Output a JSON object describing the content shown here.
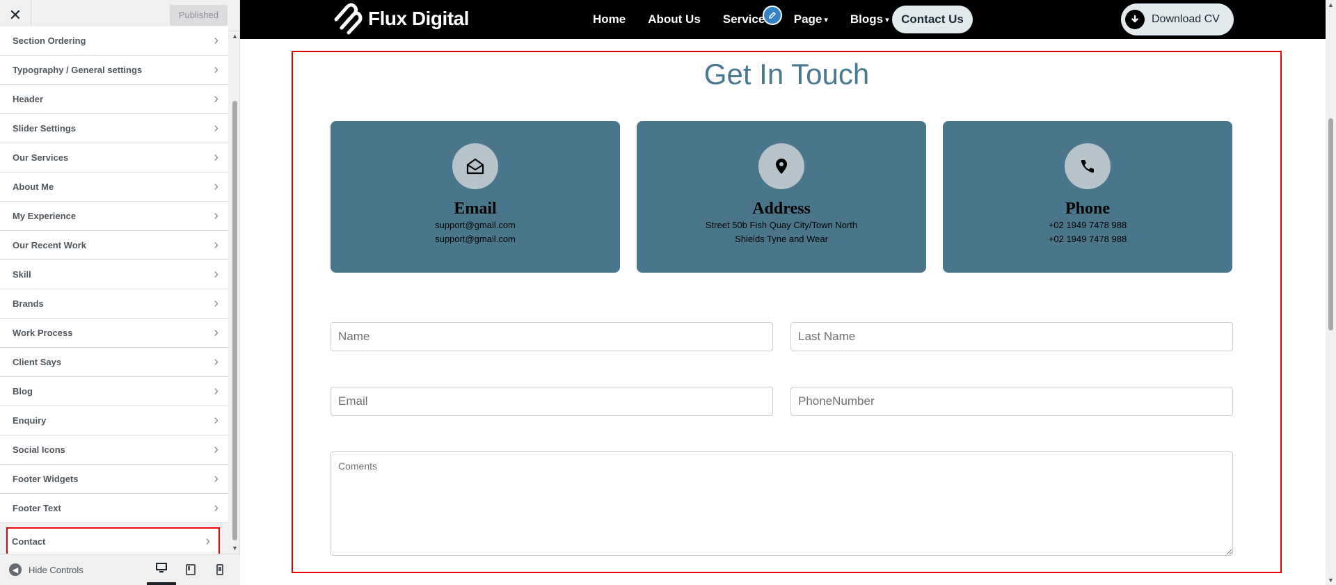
{
  "customizer": {
    "publish_label": "Published",
    "sections": [
      "Section Ordering",
      "Typography / General settings",
      "Header",
      "Slider Settings",
      "Our Services",
      "About Me",
      "My Experience",
      "Our Recent Work",
      "Skill",
      "Brands",
      "Work Process",
      "Client Says",
      "Blog",
      "Enquiry",
      "Social Icons",
      "Footer Widgets",
      "Footer Text",
      "Contact"
    ],
    "active_section": "Contact",
    "hide_controls": "Hide Controls",
    "devices": [
      "desktop-icon",
      "tablet-icon",
      "mobile-icon"
    ]
  },
  "site": {
    "brand": "Flux Digital",
    "menu": {
      "home": "Home",
      "about": "About Us",
      "services": "Services",
      "page": "Page",
      "blogs": "Blogs"
    },
    "contact_button": "Contact Us",
    "download_button": "Download CV"
  },
  "contact": {
    "title": "Get In Touch",
    "cards": [
      {
        "icon": "envelope-open-icon",
        "title": "Email",
        "lines": [
          "support@gmail.com",
          "support@gmail.com"
        ]
      },
      {
        "icon": "map-pin-icon",
        "title": "Address",
        "lines": [
          "Street 50b Fish Quay City/Town North",
          "Shields Tyne and Wear"
        ]
      },
      {
        "icon": "phone-icon",
        "title": "Phone",
        "lines": [
          "+02 1949 7478 988",
          "+02 1949 7478 988"
        ]
      }
    ],
    "form": {
      "name_placeholder": "Name",
      "last_name_placeholder": "Last Name",
      "email_placeholder": "Email",
      "phone_placeholder": "PhoneNumber",
      "comments_placeholder": "Coments"
    }
  },
  "colors": {
    "card_bg": "#4a768b",
    "title": "#4a7890",
    "highlight": "#e60000"
  }
}
